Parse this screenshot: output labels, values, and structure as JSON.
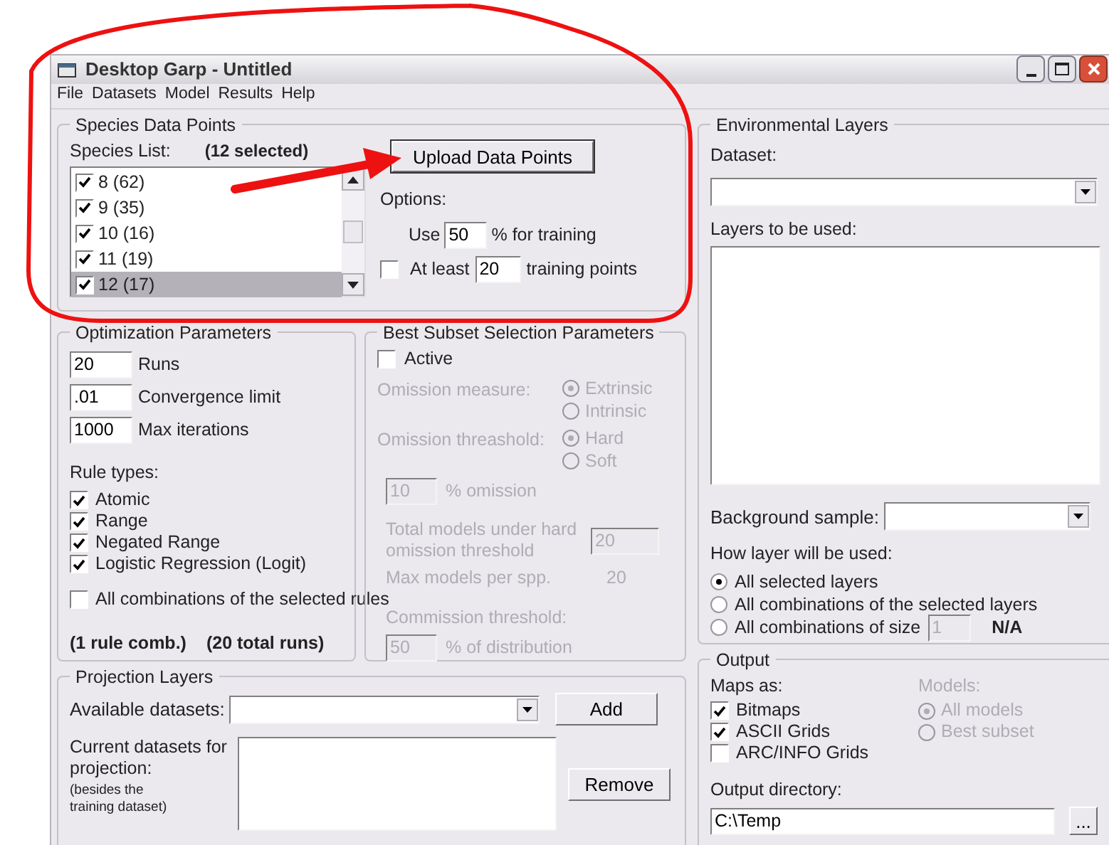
{
  "window": {
    "title": "Desktop Garp - Untitled"
  },
  "menu": [
    "File",
    "Datasets",
    "Model",
    "Results",
    "Help"
  ],
  "species": {
    "title": "Species Data Points",
    "list_label": "Species List:",
    "selected_count": "(12 selected)",
    "items": [
      {
        "label": "8 (62)",
        "checked": true,
        "selected": false
      },
      {
        "label": "9 (35)",
        "checked": true,
        "selected": false
      },
      {
        "label": "10 (16)",
        "checked": true,
        "selected": false
      },
      {
        "label": "11 (19)",
        "checked": true,
        "selected": false
      },
      {
        "label": "12 (17)",
        "checked": true,
        "selected": true
      }
    ],
    "upload_button": "Upload Data Points",
    "options_label": "Options:",
    "use_prefix": "Use",
    "use_value": "50",
    "use_suffix": "% for training",
    "at_least": {
      "checked": false,
      "label": "At least",
      "value": "20",
      "suffix": "training points"
    }
  },
  "optimization": {
    "title": "Optimization Parameters",
    "fields": [
      {
        "value": "20",
        "label": "Runs"
      },
      {
        "value": ".01",
        "label": "Convergence limit"
      },
      {
        "value": "1000",
        "label": "Max iterations"
      }
    ],
    "rule_types_label": "Rule types:",
    "rules": [
      {
        "label": "Atomic",
        "checked": true
      },
      {
        "label": "Range",
        "checked": true
      },
      {
        "label": "Negated Range",
        "checked": true
      },
      {
        "label": "Logistic Regression (Logit)",
        "checked": true
      }
    ],
    "all_combinations": {
      "label": "All combinations of the selected rules",
      "checked": false
    },
    "summary": [
      "(1 rule comb.)",
      "(20 total runs)"
    ]
  },
  "best_subset": {
    "title": "Best Subset Selection Parameters",
    "active": {
      "label": "Active",
      "checked": false
    },
    "disabled": true,
    "omission_measure": {
      "label": "Omission measure:",
      "options": [
        {
          "label": "Extrinsic",
          "selected": true
        },
        {
          "label": "Intrinsic",
          "selected": false
        }
      ]
    },
    "omission_threshold": {
      "label": "Omission threashold:",
      "options": [
        {
          "label": "Hard",
          "selected": true
        },
        {
          "label": "Soft",
          "selected": false
        }
      ]
    },
    "omission_value": "10",
    "omission_suffix": "% omission",
    "total_models_label": "Total models under hard omission threshold",
    "total_models_value": "20",
    "max_models_label": "Max models per spp.",
    "max_models_value": "20",
    "commission_label": "Commission threshold:",
    "commission_value": "50",
    "commission_suffix": "% of distribution"
  },
  "projection": {
    "title": "Projection Layers",
    "available_label": "Available datasets:",
    "add_button": "Add",
    "current_label": "Current datasets for projection:",
    "note": "(besides the training dataset)",
    "remove_button": "Remove"
  },
  "environmental": {
    "title": "Environmental Layers",
    "dataset_label": "Dataset:",
    "layers_label": "Layers to be used:",
    "background_label": "Background sample:",
    "usage_label": "How layer will be used:",
    "usage_options": [
      {
        "label": "All selected layers",
        "selected": true
      },
      {
        "label": "All combinations of the selected layers",
        "selected": false
      },
      {
        "label": "All combinations of size",
        "selected": false
      }
    ],
    "size_value": "1",
    "size_note": "N/A"
  },
  "output": {
    "title": "Output",
    "maps_label": "Maps as:",
    "maps": [
      {
        "label": "Bitmaps",
        "checked": true
      },
      {
        "label": "ASCII Grids",
        "checked": true
      },
      {
        "label": "ARC/INFO Grids",
        "checked": false
      }
    ],
    "models_label": "Models:",
    "models_disabled": true,
    "models": [
      {
        "label": "All models",
        "selected": true
      },
      {
        "label": "Best subset",
        "selected": false
      }
    ],
    "directory_label": "Output directory:",
    "directory_value": "C:\\Temp",
    "browse_button": "..."
  }
}
